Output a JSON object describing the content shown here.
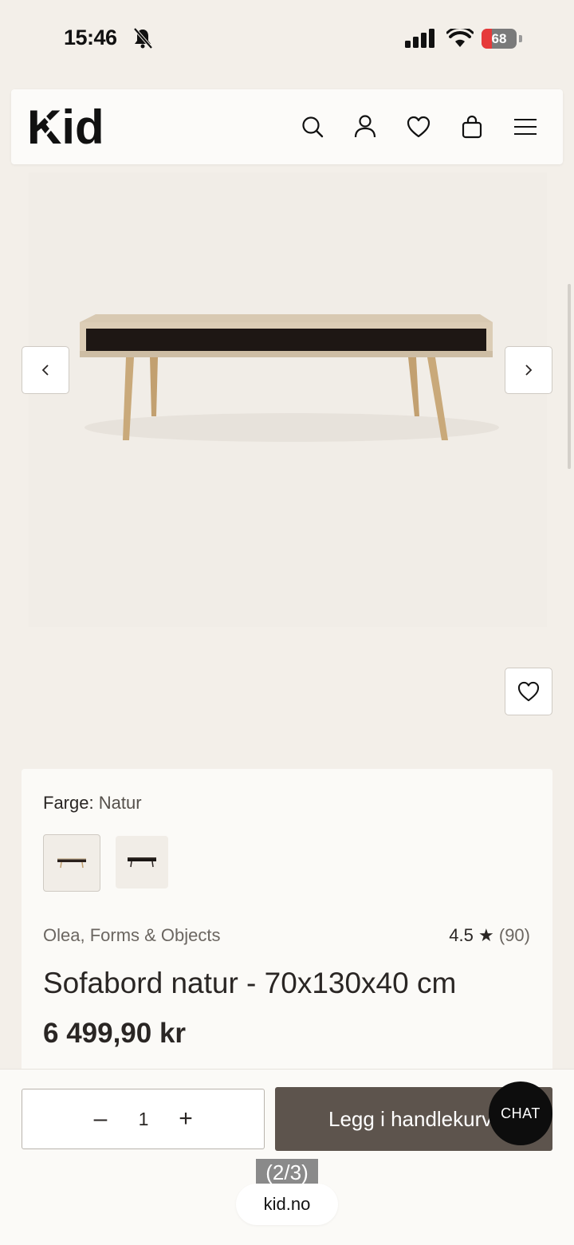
{
  "status_bar": {
    "time": "15:46",
    "battery": "68",
    "battery_level": 0.3
  },
  "header": {
    "logo": "Kid",
    "icons": [
      "search-icon",
      "account-icon",
      "heart-icon",
      "bag-icon",
      "menu-icon"
    ]
  },
  "gallery": {
    "prev_icon": "chevron-left-icon",
    "next_icon": "chevron-right-icon",
    "favorite_icon": "heart-icon"
  },
  "product": {
    "color_label": "Farge:",
    "color_value": "Natur",
    "brand": "Olea, Forms & Objects",
    "rating": "4.5",
    "rating_star": "★",
    "review_count": "(90)",
    "title": "Sofabord natur - 70x130x40 cm",
    "price": "6 499,90 kr"
  },
  "cart": {
    "minus": "–",
    "quantity": "1",
    "plus": "+",
    "add_button": "Legg i handlekurv"
  },
  "chat": {
    "label": "CHAT"
  },
  "overlay": {
    "page_counter": "(2/3)",
    "url": "kid.no"
  },
  "colors": {
    "background": "#f3efe9",
    "button": "#5d544d",
    "chat": "#0d0d0d"
  }
}
